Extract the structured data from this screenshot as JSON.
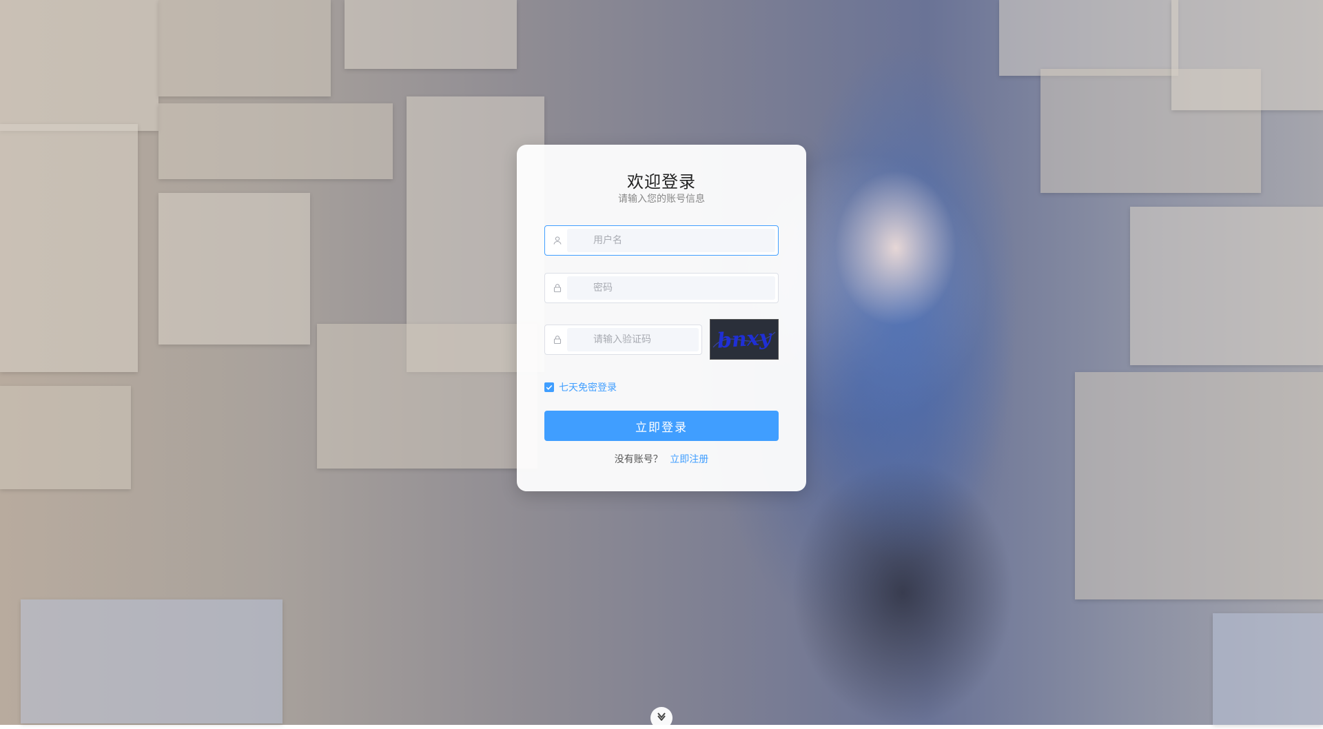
{
  "login": {
    "title": "欢迎登录",
    "subtitle": "请输入您的账号信息",
    "username_placeholder": "用户名",
    "password_placeholder": "密码",
    "captcha_placeholder": "请输入验证码",
    "captcha_text": "bnxy",
    "remember_label": "七天免密登录",
    "remember_checked": true,
    "submit_label": "立即登录",
    "register_prompt": "没有账号？",
    "register_link": "立即注册"
  },
  "icons": {
    "username": "user-icon",
    "password": "lock-icon",
    "captcha": "lock-icon",
    "scroll": "chevron-down-icon"
  },
  "colors": {
    "accent": "#409eff",
    "card_bg": "#ffffff",
    "captcha_bg": "#2a2f3a",
    "captcha_text": "#1f2fd6"
  }
}
